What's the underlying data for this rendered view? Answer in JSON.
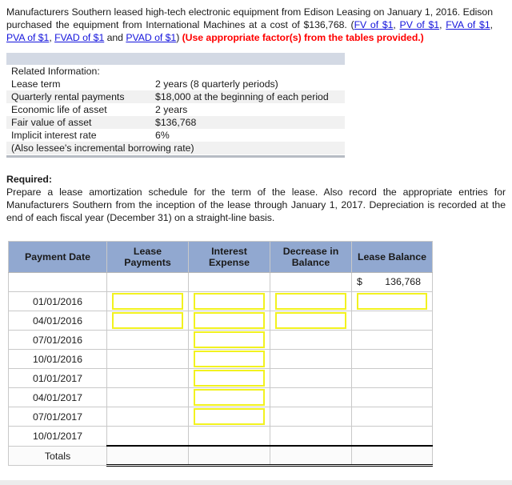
{
  "problem": {
    "intro_part1": "Manufacturers Southern leased high-tech electronic equipment from Edison Leasing on January 1, 2016. Edison purchased the equipment from International Machines at a cost of $136,768. (",
    "links": [
      "FV of $1",
      "PV of $1",
      "FVA of $1",
      "PVA of $1",
      "FVAD of $1",
      "PVAD of $1"
    ],
    "sep_comma": ", ",
    "sep_and": " and ",
    "close_paren": ") ",
    "red_note": "(Use appropriate factor(s) from the tables provided.)"
  },
  "related_info": {
    "title": "Related Information:",
    "rows": [
      {
        "label": "Lease term",
        "value": "2 years (8 quarterly periods)"
      },
      {
        "label": "Quarterly rental payments",
        "value": "$18,000 at the beginning of each period"
      },
      {
        "label": "Economic life of asset",
        "value": "2 years"
      },
      {
        "label": "Fair value of asset",
        "value": "$136,768"
      },
      {
        "label": "Implicit interest rate",
        "value": "6%"
      },
      {
        "label": "(Also lessee's incremental borrowing rate)",
        "value": ""
      }
    ]
  },
  "required": {
    "heading": "Required:",
    "body": "Prepare a lease amortization schedule for the term of the lease. Also record the appropriate entries for Manufacturers Southern from the inception of the lease through January 1, 2017. Depreciation is recorded at the end of each fiscal year (December 31) on a straight-line basis."
  },
  "amortization": {
    "headers": [
      "Payment Date",
      "Lease Payments",
      "Interest Expense",
      "Decrease in Balance",
      "Lease Balance"
    ],
    "header_lines": [
      [
        "Payment Date"
      ],
      [
        "Lease",
        "Payments"
      ],
      [
        "Interest",
        "Expense"
      ],
      [
        "Decrease in",
        "Balance"
      ],
      [
        "Lease Balance"
      ]
    ],
    "opening_row": {
      "date": "",
      "lease_payments": "",
      "interest_expense": "",
      "decrease_in_balance": "",
      "currency_symbol": "$",
      "lease_balance": "136,768"
    },
    "rows": [
      {
        "date": "01/01/2016",
        "inputs": [
          "lease_payments",
          "interest_expense",
          "decrease_in_balance",
          "lease_balance"
        ]
      },
      {
        "date": "04/01/2016",
        "inputs": [
          "lease_payments",
          "interest_expense",
          "decrease_in_balance"
        ]
      },
      {
        "date": "07/01/2016",
        "inputs": [
          "interest_expense"
        ]
      },
      {
        "date": "10/01/2016",
        "inputs": [
          "interest_expense"
        ]
      },
      {
        "date": "01/01/2017",
        "inputs": [
          "interest_expense"
        ]
      },
      {
        "date": "04/01/2017",
        "inputs": [
          "interest_expense"
        ]
      },
      {
        "date": "07/01/2017",
        "inputs": [
          "interest_expense"
        ]
      },
      {
        "date": "10/01/2017",
        "inputs": []
      }
    ],
    "totals_label": "Totals",
    "totals": {
      "lease_payments": "",
      "interest_expense": "",
      "decrease_in_balance": "",
      "lease_balance": ""
    }
  },
  "colors": {
    "header_blue": "#91a8d0",
    "band_gray": "#d3d9e4",
    "link_blue": "#1414dc",
    "note_red": "#ff0000",
    "input_yellow": "#f2f21f",
    "row_alt": "#f1f1f1"
  }
}
